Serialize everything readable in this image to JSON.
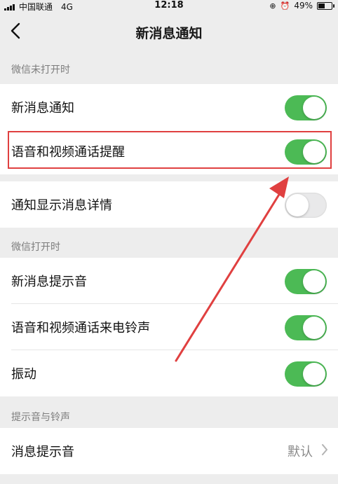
{
  "status_bar": {
    "carrier": "中国联通",
    "network": "4G",
    "time": "12:18",
    "battery": "49%",
    "battery_level": 0.49
  },
  "nav": {
    "back_icon": "chevron-left-icon",
    "title": "新消息通知"
  },
  "sections": [
    {
      "header": "微信未打开时",
      "items": [
        {
          "label": "新消息通知",
          "toggle": true
        },
        {
          "label": "语音和视频通话提醒",
          "toggle": true,
          "highlighted": true
        },
        {
          "label": "通知显示消息详情",
          "toggle": false
        }
      ]
    },
    {
      "header": "微信打开时",
      "items": [
        {
          "label": "新消息提示音",
          "toggle": true
        },
        {
          "label": "语音和视频通话来电铃声",
          "toggle": true
        },
        {
          "label": "振动",
          "toggle": true
        }
      ]
    },
    {
      "header": "提示音与铃声",
      "items": [
        {
          "label": "消息提示音",
          "value": "默认"
        }
      ]
    }
  ],
  "colors": {
    "toggle_on": "#4cba55",
    "toggle_off": "#e9e9ea",
    "annotation": "#e04040",
    "background": "#ededed"
  }
}
